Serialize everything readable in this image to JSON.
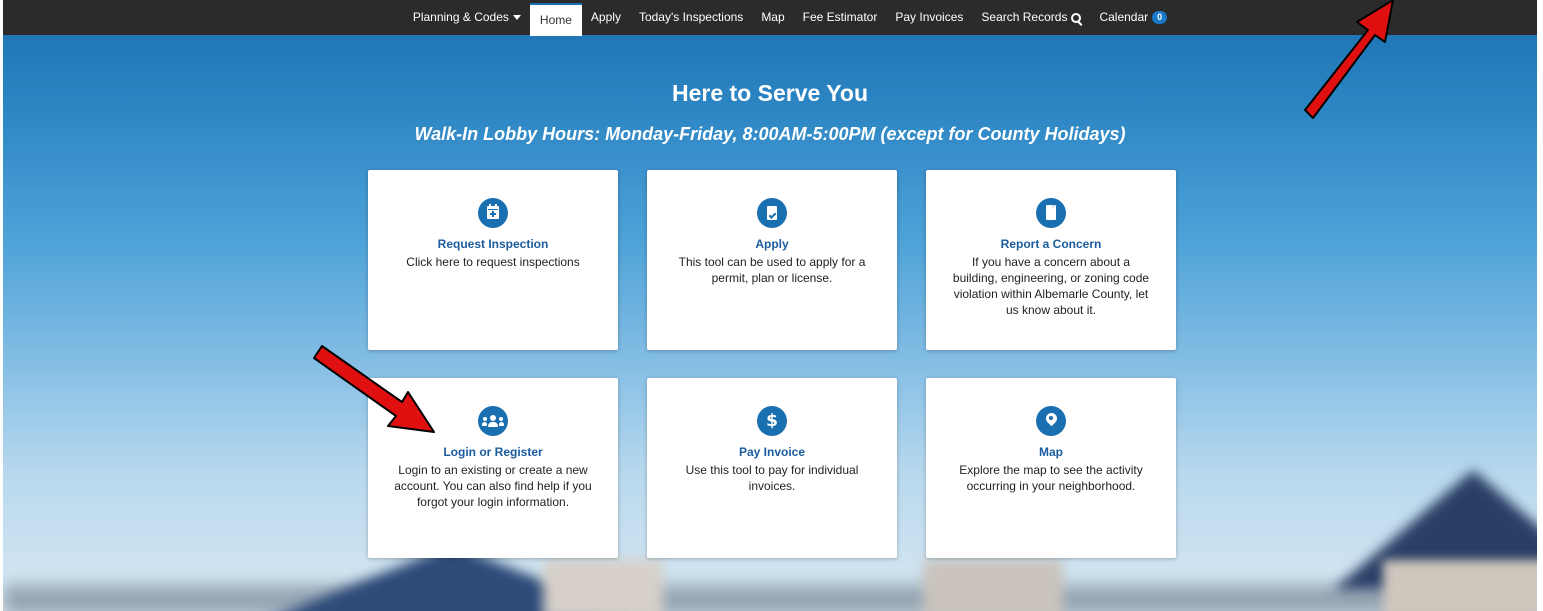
{
  "nav": {
    "planning": "Planning & Codes",
    "home": "Home",
    "apply": "Apply",
    "inspections": "Today's Inspections",
    "map": "Map",
    "fee": "Fee Estimator",
    "pay": "Pay Invoices",
    "search": "Search Records",
    "calendar": "Calendar",
    "calendar_count": "0"
  },
  "hero": {
    "title": "Here to Serve You",
    "subtitle": "Walk-In Lobby Hours: Monday-Friday, 8:00AM-5:00PM (except for County Holidays)"
  },
  "cards": [
    {
      "icon": "calendar-plus-icon",
      "title": "Request Inspection",
      "desc": "Click here to request inspections"
    },
    {
      "icon": "clipboard-check-icon",
      "title": "Apply",
      "desc": "This tool can be used to apply for a permit, plan or license."
    },
    {
      "icon": "document-icon",
      "title": "Report a Concern",
      "desc": "If you have a concern about a building, engineering, or zoning code violation within Albemarle County, let us know about it."
    },
    {
      "icon": "users-icon",
      "title": "Login or Register",
      "desc": "Login to an existing or create a new account. You can also find help if you forgot your login information."
    },
    {
      "icon": "dollar-icon",
      "title": "Pay Invoice",
      "desc": "Use this tool to pay for individual invoices."
    },
    {
      "icon": "map-pin-icon",
      "title": "Map",
      "desc": "Explore the map to see the activity occurring in your neighborhood."
    }
  ],
  "colors": {
    "accent": "#1a6fb0",
    "nav_bg": "#2b2b2b",
    "arrow": "#e11010"
  }
}
